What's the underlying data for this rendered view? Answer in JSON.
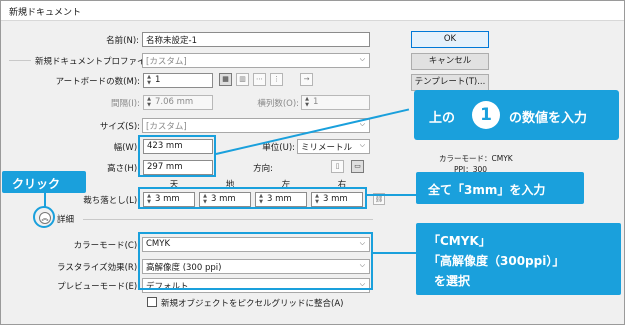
{
  "window": {
    "title": "新規ドキュメント"
  },
  "buttons": {
    "ok": "OK",
    "cancel": "キャンセル",
    "template": "テンプレート(T)..."
  },
  "name": {
    "label": "名前(N):",
    "value": "名称未設定-1"
  },
  "profile": {
    "label": "新規ドキュメントプロファイル(P):",
    "value": "[カスタム]"
  },
  "artboards": {
    "label": "アートボードの数(M):",
    "value": "1"
  },
  "spacing": {
    "label": "間隔(I):",
    "value": "7.06 mm"
  },
  "columns": {
    "label": "横列数(O):",
    "value": "1"
  },
  "size": {
    "label": "サイズ(S):",
    "value": "[カスタム]"
  },
  "width": {
    "label": "幅(W):",
    "value": "423  mm"
  },
  "height": {
    "label": "高さ(H):",
    "value": "297 mm"
  },
  "unit": {
    "label": "単位(U):",
    "value": "ミリメートル"
  },
  "orientation": {
    "label": "方向:"
  },
  "bleed": {
    "label": "裁ち落とし(L):",
    "headers": [
      "天",
      "地",
      "左",
      "右"
    ],
    "values": [
      "3 mm",
      "3 mm",
      "3 mm",
      "3 mm"
    ]
  },
  "advanced": {
    "label": "詳細"
  },
  "color_mode": {
    "label": "カラーモード(C):",
    "value": "CMYK"
  },
  "raster": {
    "label": "ラスタライズ効果(R):",
    "value": "高解像度 (300 ppi)"
  },
  "preview": {
    "label": "プレビューモード(E):",
    "value": "デフォルト"
  },
  "align_pixel": {
    "label": "新規オブジェクトをピクセルグリッドに整合(A)"
  },
  "info": {
    "color_mode": "カラーモード：CMYK",
    "ppi": "PPI：300"
  },
  "callouts": {
    "input_pre": "上の",
    "number": "1",
    "input_post": "の数値を入力",
    "click": "クリック",
    "bleed": "全て「3mm」を入力",
    "cmyk_line1": "「CMYK」",
    "cmyk_line2": "「高解像度（300ppi）」",
    "cmyk_line3": "を選択"
  },
  "colors": {
    "accent": "#1aa0dc",
    "panel": "#f0f0f0"
  }
}
